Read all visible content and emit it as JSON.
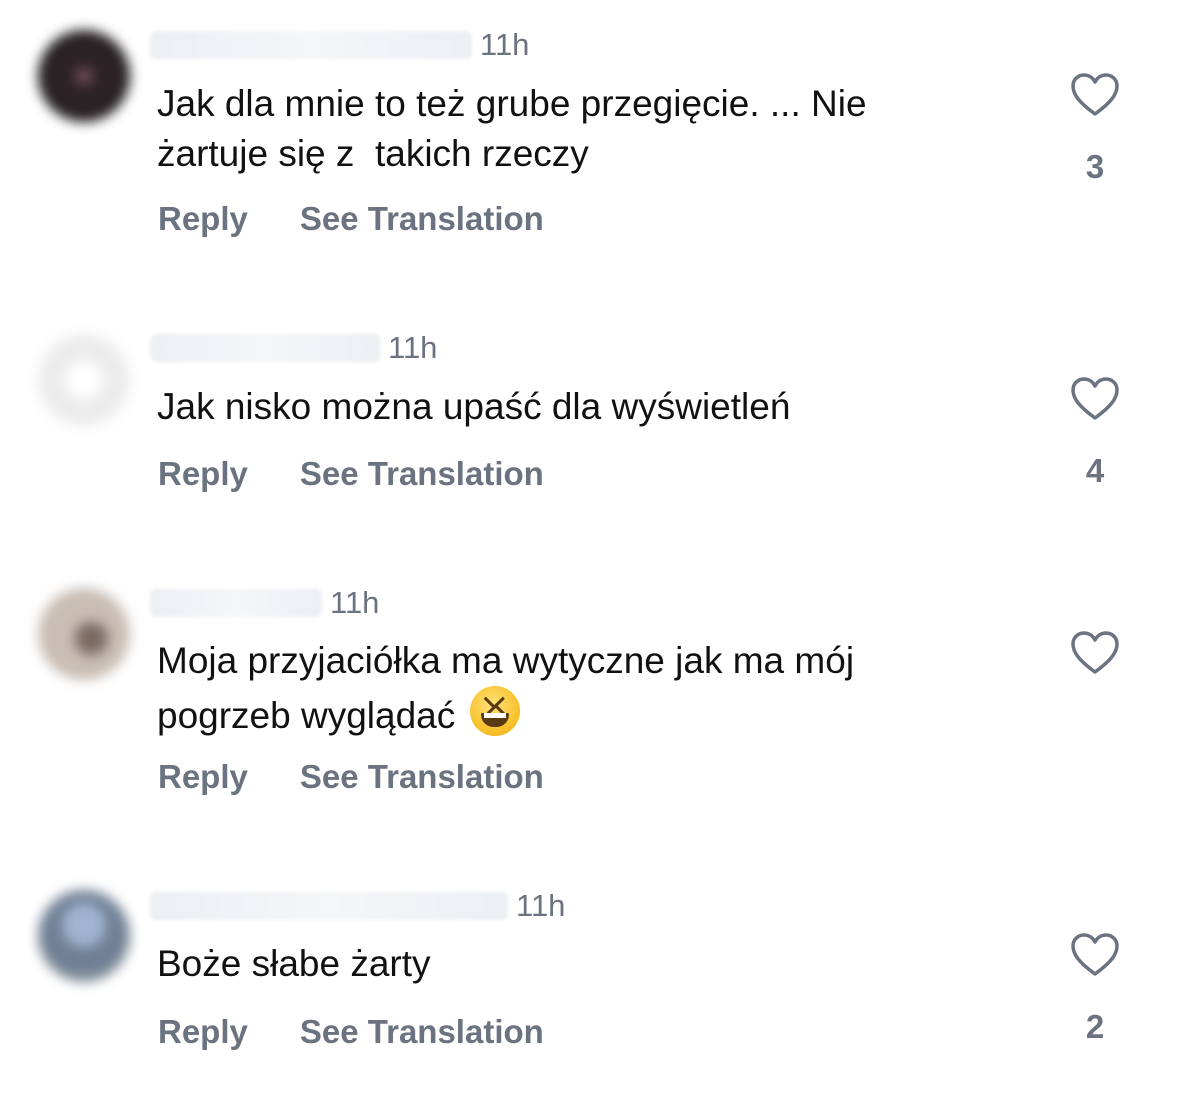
{
  "comments": [
    {
      "time": "11h",
      "text": "Jak dla mnie to też grube przegięcie. ... Nie\nżartuje się z  takich rzeczy",
      "likes": "3",
      "reply_label": "Reply",
      "translate_label": "See Translation"
    },
    {
      "time": "11h",
      "text": "Jak nisko można upaść dla wyświetleń",
      "likes": "4",
      "reply_label": "Reply",
      "translate_label": "See Translation"
    },
    {
      "time": "11h",
      "text": "Moja przyjaciółka ma wytyczne jak ma mój\npogrzeb wyglądać ",
      "emoji": "grinning-squinting-face",
      "likes": "",
      "reply_label": "Reply",
      "translate_label": "See Translation"
    },
    {
      "time": "11h",
      "text": "Boże słabe żarty",
      "likes": "2",
      "reply_label": "Reply",
      "translate_label": "See Translation"
    }
  ],
  "icons": {
    "like": "heart-outline-icon"
  },
  "colors": {
    "text": "#111111",
    "muted": "#6b7280",
    "background": "#ffffff"
  }
}
